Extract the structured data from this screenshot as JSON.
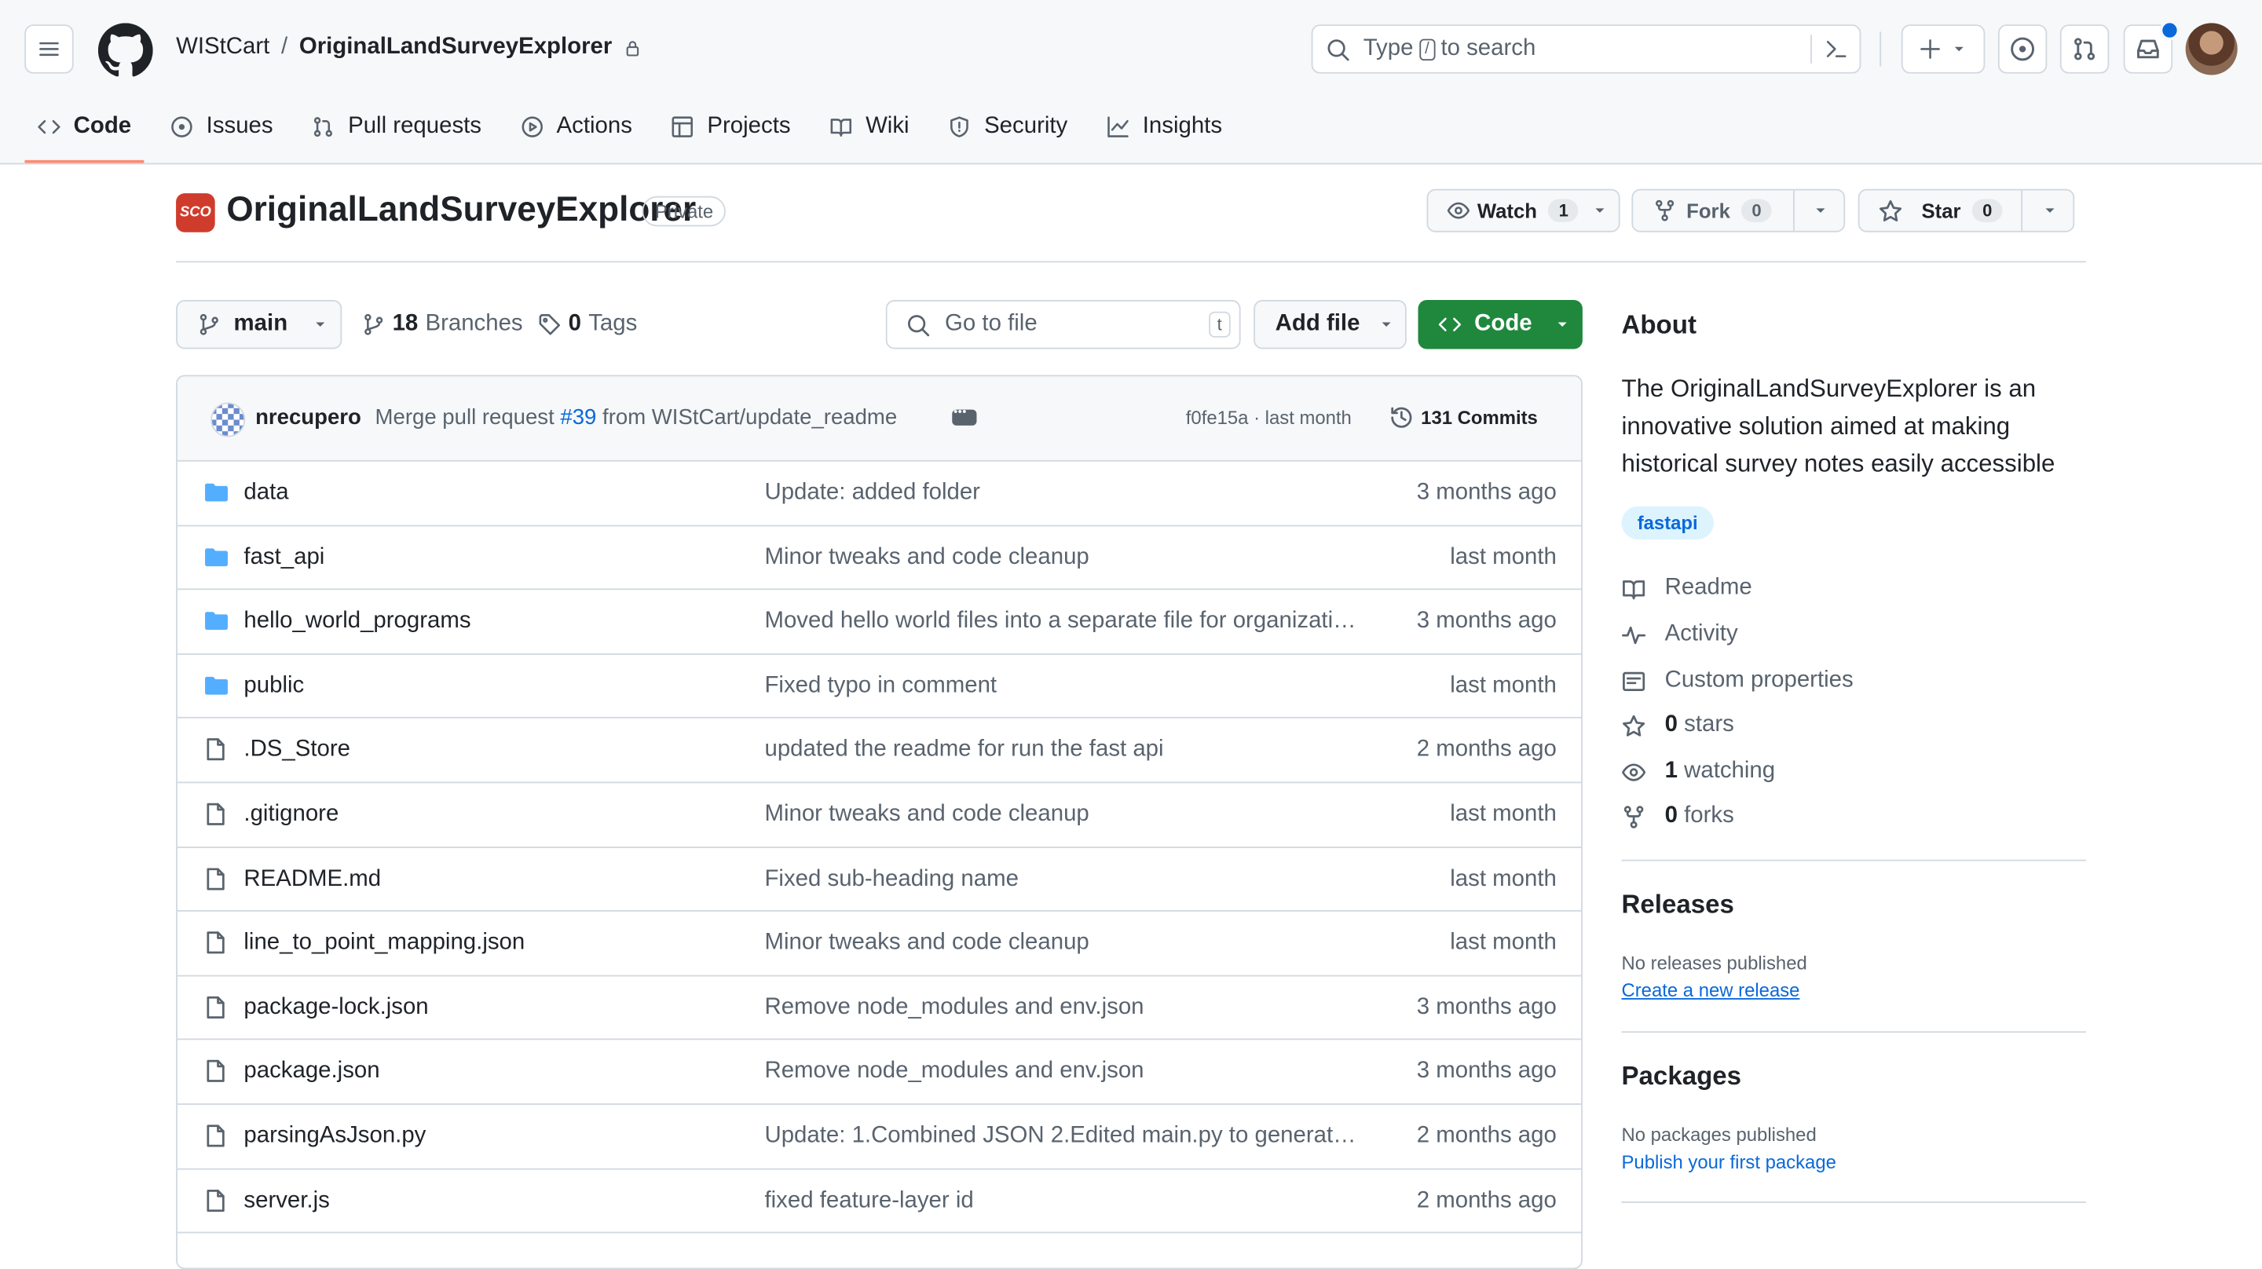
{
  "header": {
    "owner": "WIStCart",
    "repo": "OriginalLandSurveyExplorer",
    "search_prefix": "Type",
    "search_key": "/",
    "search_suffix": "to search"
  },
  "tabs": [
    {
      "label": "Code",
      "icon": "code-icon"
    },
    {
      "label": "Issues",
      "icon": "issue-icon"
    },
    {
      "label": "Pull requests",
      "icon": "pull-request-icon"
    },
    {
      "label": "Actions",
      "icon": "play-icon"
    },
    {
      "label": "Projects",
      "icon": "table-icon"
    },
    {
      "label": "Wiki",
      "icon": "book-icon"
    },
    {
      "label": "Security",
      "icon": "shield-icon"
    },
    {
      "label": "Insights",
      "icon": "graph-icon"
    }
  ],
  "repo": {
    "icon_text": "SCO",
    "name": "OriginalLandSurveyExplorer",
    "visibility": "Private",
    "watch_label": "Watch",
    "watch_count": "1",
    "fork_label": "Fork",
    "fork_count": "0",
    "star_label": "Star",
    "star_count": "0"
  },
  "toolbar": {
    "branch": "main",
    "branches_count": "18",
    "branches_label": "Branches",
    "tags_count": "0",
    "tags_label": "Tags",
    "goto_placeholder": "Go to file",
    "goto_key": "t",
    "add_file": "Add file",
    "code": "Code"
  },
  "commit": {
    "user": "nrecupero",
    "msg_before": "Merge pull request",
    "pr": "#39",
    "msg_after": "from WIStCart/update_readme",
    "sha": "f0fe15a · last month",
    "commits": "131 Commits"
  },
  "files": [
    {
      "type": "dir",
      "name": "data",
      "msg": "Update: added folder",
      "date": "3 months ago"
    },
    {
      "type": "dir",
      "name": "fast_api",
      "msg": "Minor tweaks and code cleanup",
      "date": "last month"
    },
    {
      "type": "dir",
      "name": "hello_world_programs",
      "msg": "Moved hello world files into a separate file for organizatio...",
      "date": "3 months ago"
    },
    {
      "type": "dir",
      "name": "public",
      "msg": "Fixed typo in comment",
      "date": "last month"
    },
    {
      "type": "file",
      "name": ".DS_Store",
      "msg": "updated the readme for run the fast api",
      "date": "2 months ago"
    },
    {
      "type": "file",
      "name": ".gitignore",
      "msg": "Minor tweaks and code cleanup",
      "date": "last month"
    },
    {
      "type": "file",
      "name": "README.md",
      "msg": "Fixed sub-heading name",
      "date": "last month"
    },
    {
      "type": "file",
      "name": "line_to_point_mapping.json",
      "msg": "Minor tweaks and code cleanup",
      "date": "last month"
    },
    {
      "type": "file",
      "name": "package-lock.json",
      "msg": "Remove node_modules and env.json",
      "date": "3 months ago"
    },
    {
      "type": "file",
      "name": "package.json",
      "msg": "Remove node_modules and env.json",
      "date": "3 months ago"
    },
    {
      "type": "file",
      "name": "parsingAsJson.py",
      "msg": "Update: 1.Combined JSON 2.Edited main.py to generate i...",
      "date": "2 months ago"
    },
    {
      "type": "file",
      "name": "server.js",
      "msg": "fixed feature-layer id",
      "date": "2 months ago"
    }
  ],
  "about": {
    "heading": "About",
    "description": "The OriginalLandSurveyExplorer is an innovative solution aimed at making historical survey notes easily accessible",
    "topic": "fastapi",
    "readme": "Readme",
    "activity": "Activity",
    "custom_properties": "Custom properties",
    "stars_count": "0",
    "stars_label": "stars",
    "watching_count": "1",
    "watching_label": "watching",
    "forks_count": "0",
    "forks_label": "forks"
  },
  "releases": {
    "heading": "Releases",
    "none": "No releases published",
    "link": "Create a new release"
  },
  "packages": {
    "heading": "Packages",
    "none": "No packages published",
    "link": "Publish your first package"
  },
  "colors": {
    "accent": "#0969da",
    "primary_button": "#1f883d",
    "selected_tab_underline": "#fd8c73",
    "folder": "#54aeff"
  }
}
